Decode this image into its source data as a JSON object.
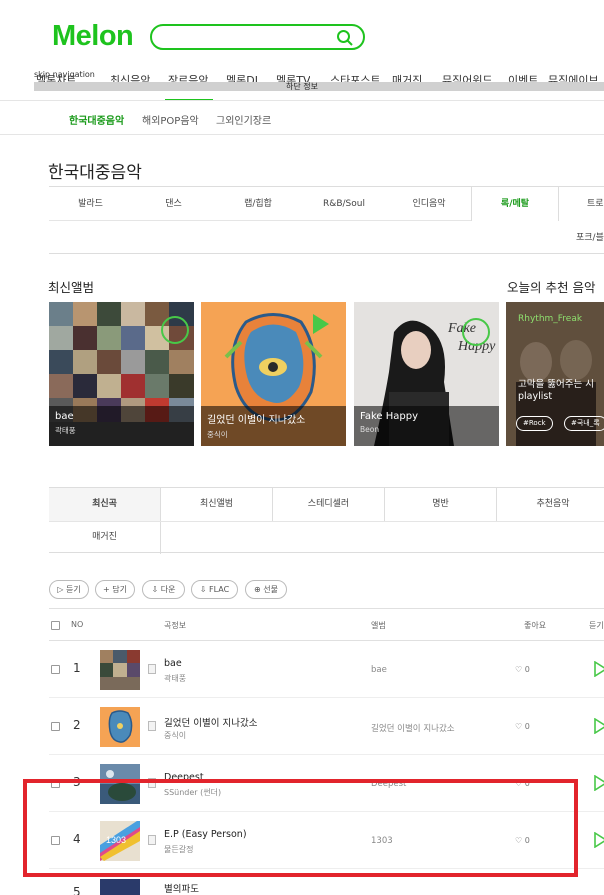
{
  "header": {
    "logo": "Melon",
    "search": {
      "placeholder": ""
    },
    "skip_nav": "skip navigation",
    "gnb_items": [
      "멜론차트",
      "최신음악",
      "장르음악",
      "멜론DJ",
      "멜론TV",
      "스타포스트",
      "매거진",
      "뮤직어워드",
      "이벤트",
      "뮤직에이브"
    ],
    "gnb_bar_label": "하단 정보"
  },
  "subnav": [
    "한국대중음악",
    "해외POP음악",
    "그외인기장르"
  ],
  "page_title": "한국대중음악",
  "genres": [
    "발라드",
    "댄스",
    "랩/힙합",
    "R&B/Soul",
    "인디음악",
    "록/메탈",
    "트로"
  ],
  "genres_row2": [
    "포크/블"
  ],
  "sections": {
    "new_albums": "최신앨범",
    "recommend": "오늘의 추천 음악"
  },
  "cards": [
    {
      "title": "bae",
      "artist": "곽태풍"
    },
    {
      "title": "길었던 이별이 지나갔소",
      "artist": "중식이"
    },
    {
      "title": "Fake Happy",
      "artist": "Beon"
    },
    {
      "title": "고막을 뚫어주는 시",
      "artist": "playlist",
      "user": "Rhythm_Freak",
      "tags": [
        "#Rock",
        "#국내_록"
      ]
    }
  ],
  "tabs": [
    "최신곡",
    "최신앨범",
    "스테디셀러",
    "명반",
    "추천음악",
    "매거진"
  ],
  "actions": [
    "듣기",
    "담기",
    "다운",
    "FLAC",
    "선물"
  ],
  "table": {
    "headers": [
      "NO",
      "곡정보",
      "앨범",
      "좋아요",
      "듣기"
    ],
    "rows": [
      {
        "no": "1",
        "title": "bae",
        "artist": "곽태풍",
        "album": "bae",
        "likes": "0"
      },
      {
        "no": "2",
        "title": "길었던 이별이 지나갔소",
        "artist": "중식이",
        "album": "길었던 이별이 지나갔소",
        "likes": "0"
      },
      {
        "no": "3",
        "title": "Deepest",
        "artist": "SSünder (썬더)",
        "album": "Deepest",
        "likes": "0"
      },
      {
        "no": "4",
        "title": "E.P (Easy Person)",
        "artist": "물든갈정",
        "album": "1303",
        "likes": "0"
      },
      {
        "no": "5",
        "title": "별의파도",
        "artist": "",
        "album": "",
        "likes": ""
      }
    ]
  },
  "colors": {
    "brand": "#1ec31e",
    "highlight": "#e2242c"
  }
}
